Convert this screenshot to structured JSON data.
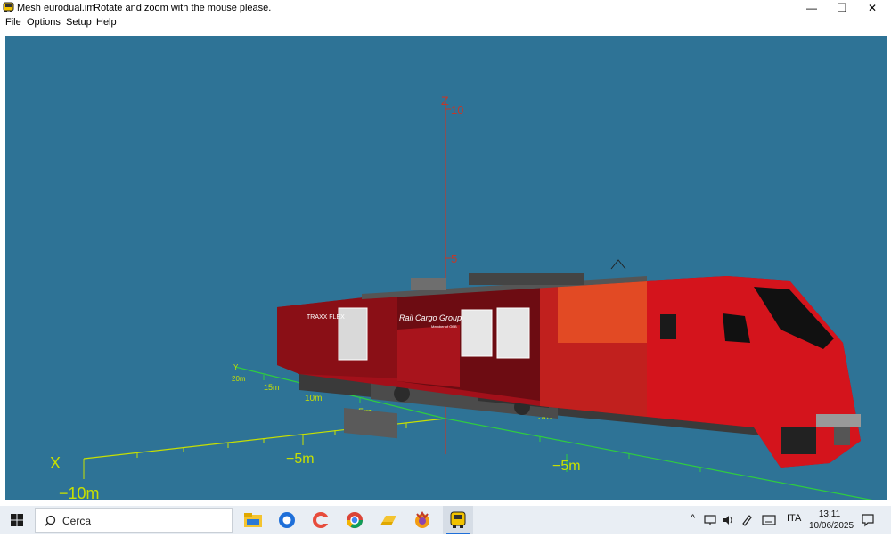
{
  "window": {
    "title": "Mesh eurodual.im",
    "message": "Rotate and zoom with the mouse please.",
    "minimize_glyph": "—",
    "restore_glyph": "❐",
    "close_glyph": "✕"
  },
  "menu": [
    "File",
    "Options",
    "Setup",
    "Help"
  ],
  "viewport": {
    "background": "#2e7396",
    "axes": {
      "z_label": "Z",
      "z_ticks": [
        "10",
        "5"
      ],
      "x_label": "X",
      "x_ticks": [
        "−10m",
        "−5m"
      ],
      "y_label": "Y",
      "y_ticks": [
        "20m",
        "15m",
        "10m",
        "5m"
      ],
      "front_tick": "−5m",
      "front_mid_tick": "5m"
    },
    "model": {
      "side_text_1": "TRAXX FLEX",
      "logo_text": "Rail Cargo Group",
      "logo_sub": "Member of ÖBB"
    }
  },
  "taskbar": {
    "search_placeholder": "Cerca",
    "tray_lang": "ITA",
    "time": "13:11",
    "date": "10/06/2025",
    "tray_chevron": "^"
  }
}
